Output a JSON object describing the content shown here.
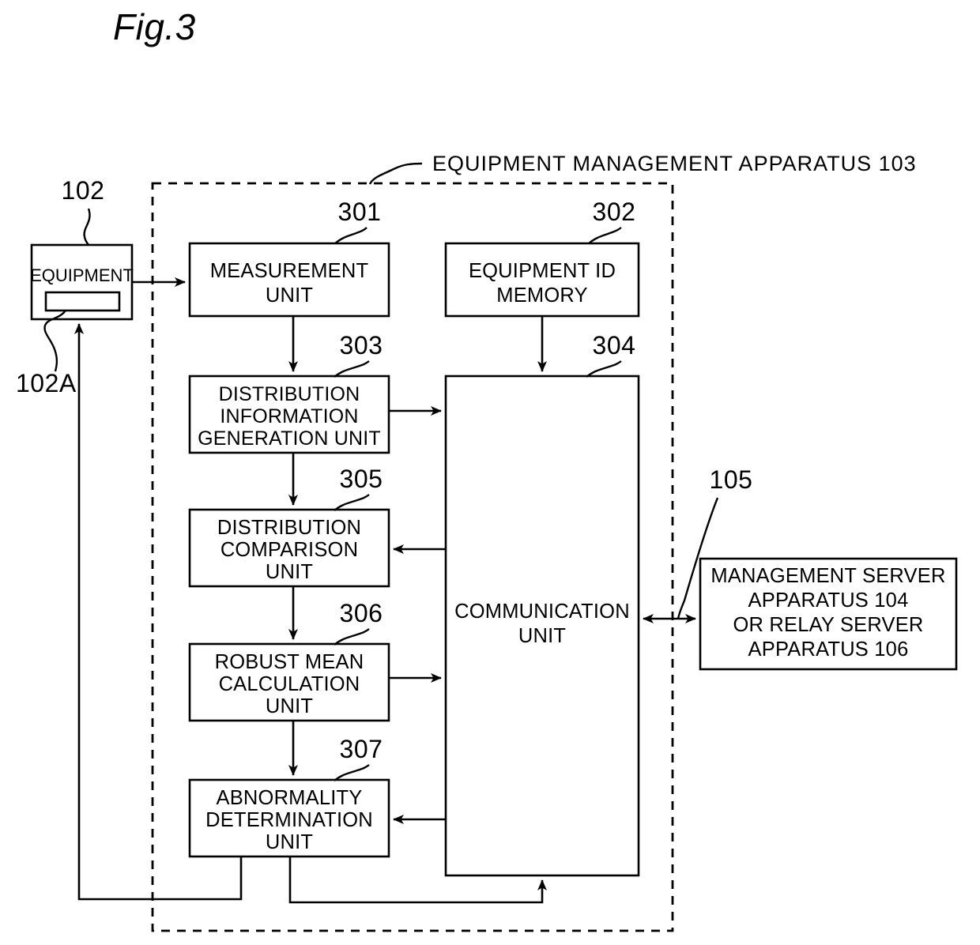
{
  "figure": {
    "title": "Fig.3",
    "header_label": "EQUIPMENT MANAGEMENT APPARATUS 103"
  },
  "refs": {
    "equipment": "102",
    "equipment_inner": "102A",
    "measurement_unit": "301",
    "equipment_id_memory": "302",
    "distribution_information_generation_unit": "303",
    "communication_unit": "304",
    "distribution_comparison_unit": "305",
    "robust_mean_calculation_unit": "306",
    "abnormality_determination_unit": "307",
    "server_link": "105"
  },
  "blocks": {
    "equipment": {
      "lines": [
        "EQUIPMENT"
      ]
    },
    "measurement_unit": {
      "lines": [
        "MEASUREMENT",
        "UNIT"
      ]
    },
    "equipment_id_memory": {
      "lines": [
        "EQUIPMENT ID",
        "MEMORY"
      ]
    },
    "distribution_information_generation_unit": {
      "lines": [
        "DISTRIBUTION",
        "INFORMATION",
        "GENERATION UNIT"
      ]
    },
    "distribution_comparison_unit": {
      "lines": [
        "DISTRIBUTION",
        "COMPARISON",
        "UNIT"
      ]
    },
    "robust_mean_calculation_unit": {
      "lines": [
        "ROBUST MEAN",
        "CALCULATION",
        "UNIT"
      ]
    },
    "abnormality_determination_unit": {
      "lines": [
        "ABNORMALITY",
        "DETERMINATION",
        "UNIT"
      ]
    },
    "communication_unit": {
      "lines": [
        "COMMUNICATION",
        "UNIT"
      ]
    },
    "server": {
      "lines": [
        "MANAGEMENT SERVER",
        "APPARATUS 104",
        "OR RELAY SERVER",
        "APPARATUS 106"
      ]
    }
  },
  "colors": {
    "line": "#000000",
    "background": "#ffffff"
  }
}
